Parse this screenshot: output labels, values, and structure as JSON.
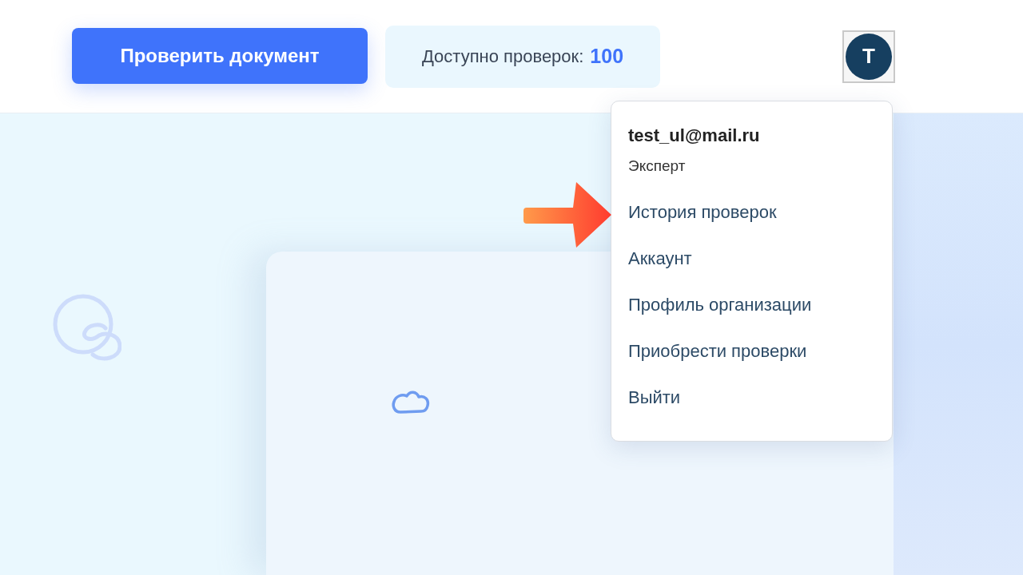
{
  "header": {
    "check_button": "Проверить документ",
    "checks_available": {
      "label": "Доступно проверок:",
      "count": "100"
    },
    "avatar": {
      "initial": "T"
    }
  },
  "user_menu": {
    "email": "test_ul@mail.ru",
    "role": "Эксперт",
    "items": [
      "История проверок",
      "Аккаунт",
      "Профиль организации",
      "Приобрести проверки",
      "Выйти"
    ]
  }
}
